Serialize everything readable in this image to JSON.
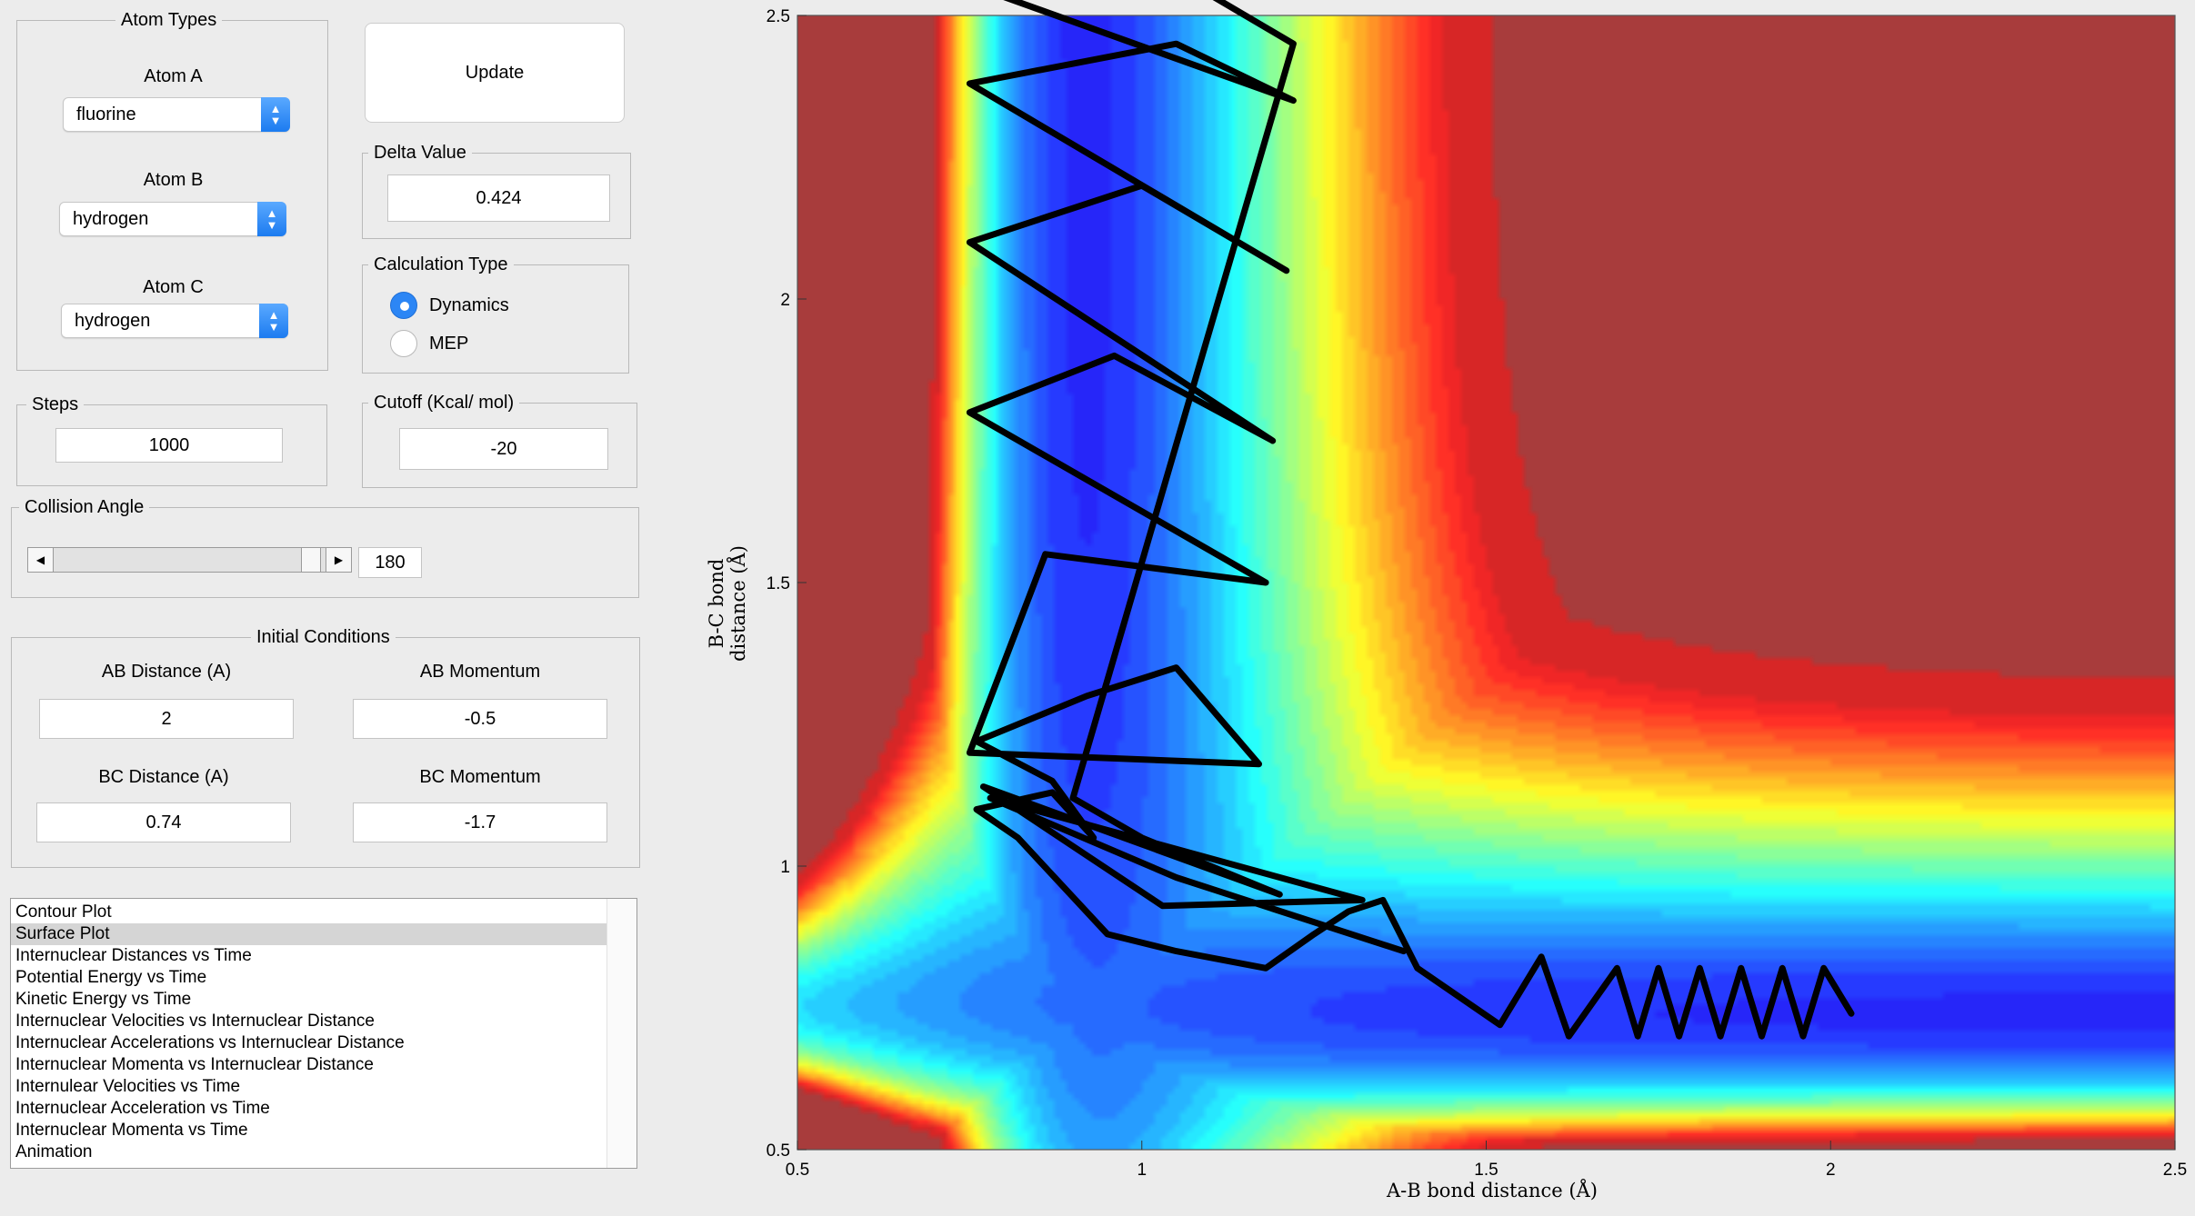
{
  "atom_types": {
    "title": "Atom Types",
    "atom_a": {
      "label": "Atom A",
      "value": "fluorine"
    },
    "atom_b": {
      "label": "Atom B",
      "value": "hydrogen"
    },
    "atom_c": {
      "label": "Atom C",
      "value": "hydrogen"
    }
  },
  "update_button": "Update",
  "delta": {
    "title": "Delta Value",
    "value": "0.424"
  },
  "calc_type": {
    "title": "Calculation Type",
    "options": [
      "Dynamics",
      "MEP"
    ],
    "selected": "Dynamics"
  },
  "steps": {
    "title": "Steps",
    "value": "1000"
  },
  "cutoff": {
    "title": "Cutoff (Kcal/ mol)",
    "value": "-20"
  },
  "collision": {
    "title": "Collision Angle",
    "value": "180"
  },
  "initial": {
    "title": "Initial Conditions",
    "ab_distance": {
      "label": "AB Distance (A)",
      "value": "2"
    },
    "ab_momentum": {
      "label": "AB Momentum",
      "value": "-0.5"
    },
    "bc_distance": {
      "label": "BC Distance (A)",
      "value": "0.74"
    },
    "bc_momentum": {
      "label": "BC Momentum",
      "value": "-1.7"
    }
  },
  "plot_list": {
    "items": [
      "Contour Plot",
      "Surface Plot",
      "Internuclear Distances vs Time",
      "Potential Energy vs Time",
      "Kinetic Energy vs Time",
      "Internuclear Velocities vs Internuclear Distance",
      "Internuclear Accelerations vs Internuclear Distance",
      "Internuclear Momenta vs Internuclear Distance",
      "Internulear Velocities vs Time",
      "Internuclear Acceleration vs Time",
      "Internuclear Momenta vs Time",
      "Animation"
    ],
    "selected_index": 1
  },
  "icons": {
    "popup": "chevron-up-down-icon",
    "slider_left": "arrow-left-icon",
    "slider_right": "arrow-right-icon"
  },
  "chart_data": {
    "type": "contour",
    "xlabel": "A-B bond distance (Å)",
    "ylabel": "B-C bond distance (Å)",
    "xlim": [
      0.5,
      2.5
    ],
    "ylim": [
      0.5,
      2.5
    ],
    "xticks": [
      0.5,
      1,
      1.5,
      2,
      2.5
    ],
    "yticks": [
      0.5,
      1,
      1.5,
      2,
      2.5
    ],
    "x_tick_labels": [
      "0.5",
      "1",
      "1.5",
      "2",
      "2.5"
    ],
    "y_tick_labels": [
      "0.5",
      "1",
      "1.5",
      "2",
      "2.5"
    ],
    "colormap": "jet",
    "trajectory": {
      "x": [
        2.03,
        1.99,
        1.96,
        1.93,
        1.9,
        1.87,
        1.84,
        1.81,
        1.78,
        1.75,
        1.72,
        1.69,
        1.62,
        1.58,
        1.52,
        1.4,
        1.35,
        1.3,
        1.25,
        1.18,
        1.05,
        0.95,
        0.82,
        0.76,
        0.87,
        0.93,
        0.87,
        0.76,
        0.92,
        1.05,
        1.17,
        0.75,
        0.86,
        1.18,
        0.75,
        0.96,
        1.19,
        0.75,
        1.0,
        1.21,
        0.75,
        1.05,
        1.22,
        0.76,
        1.08,
        1.22,
        0.9,
        1.0,
        1.2,
        0.77,
        1.03,
        1.32,
        0.78,
        1.05,
        1.38
      ],
      "y": [
        0.74,
        0.82,
        0.7,
        0.82,
        0.7,
        0.82,
        0.7,
        0.82,
        0.7,
        0.82,
        0.7,
        0.82,
        0.7,
        0.84,
        0.72,
        0.82,
        0.94,
        0.92,
        0.88,
        0.82,
        0.85,
        0.88,
        1.05,
        1.1,
        1.13,
        1.05,
        1.15,
        1.22,
        1.3,
        1.35,
        1.18,
        1.2,
        1.55,
        1.5,
        1.8,
        1.9,
        1.75,
        2.1,
        2.2,
        2.05,
        2.38,
        2.45,
        2.35,
        2.55,
        2.55,
        2.45,
        1.12,
        1.05,
        0.95,
        1.14,
        0.93,
        0.94,
        1.12,
        0.98,
        0.85
      ]
    }
  }
}
